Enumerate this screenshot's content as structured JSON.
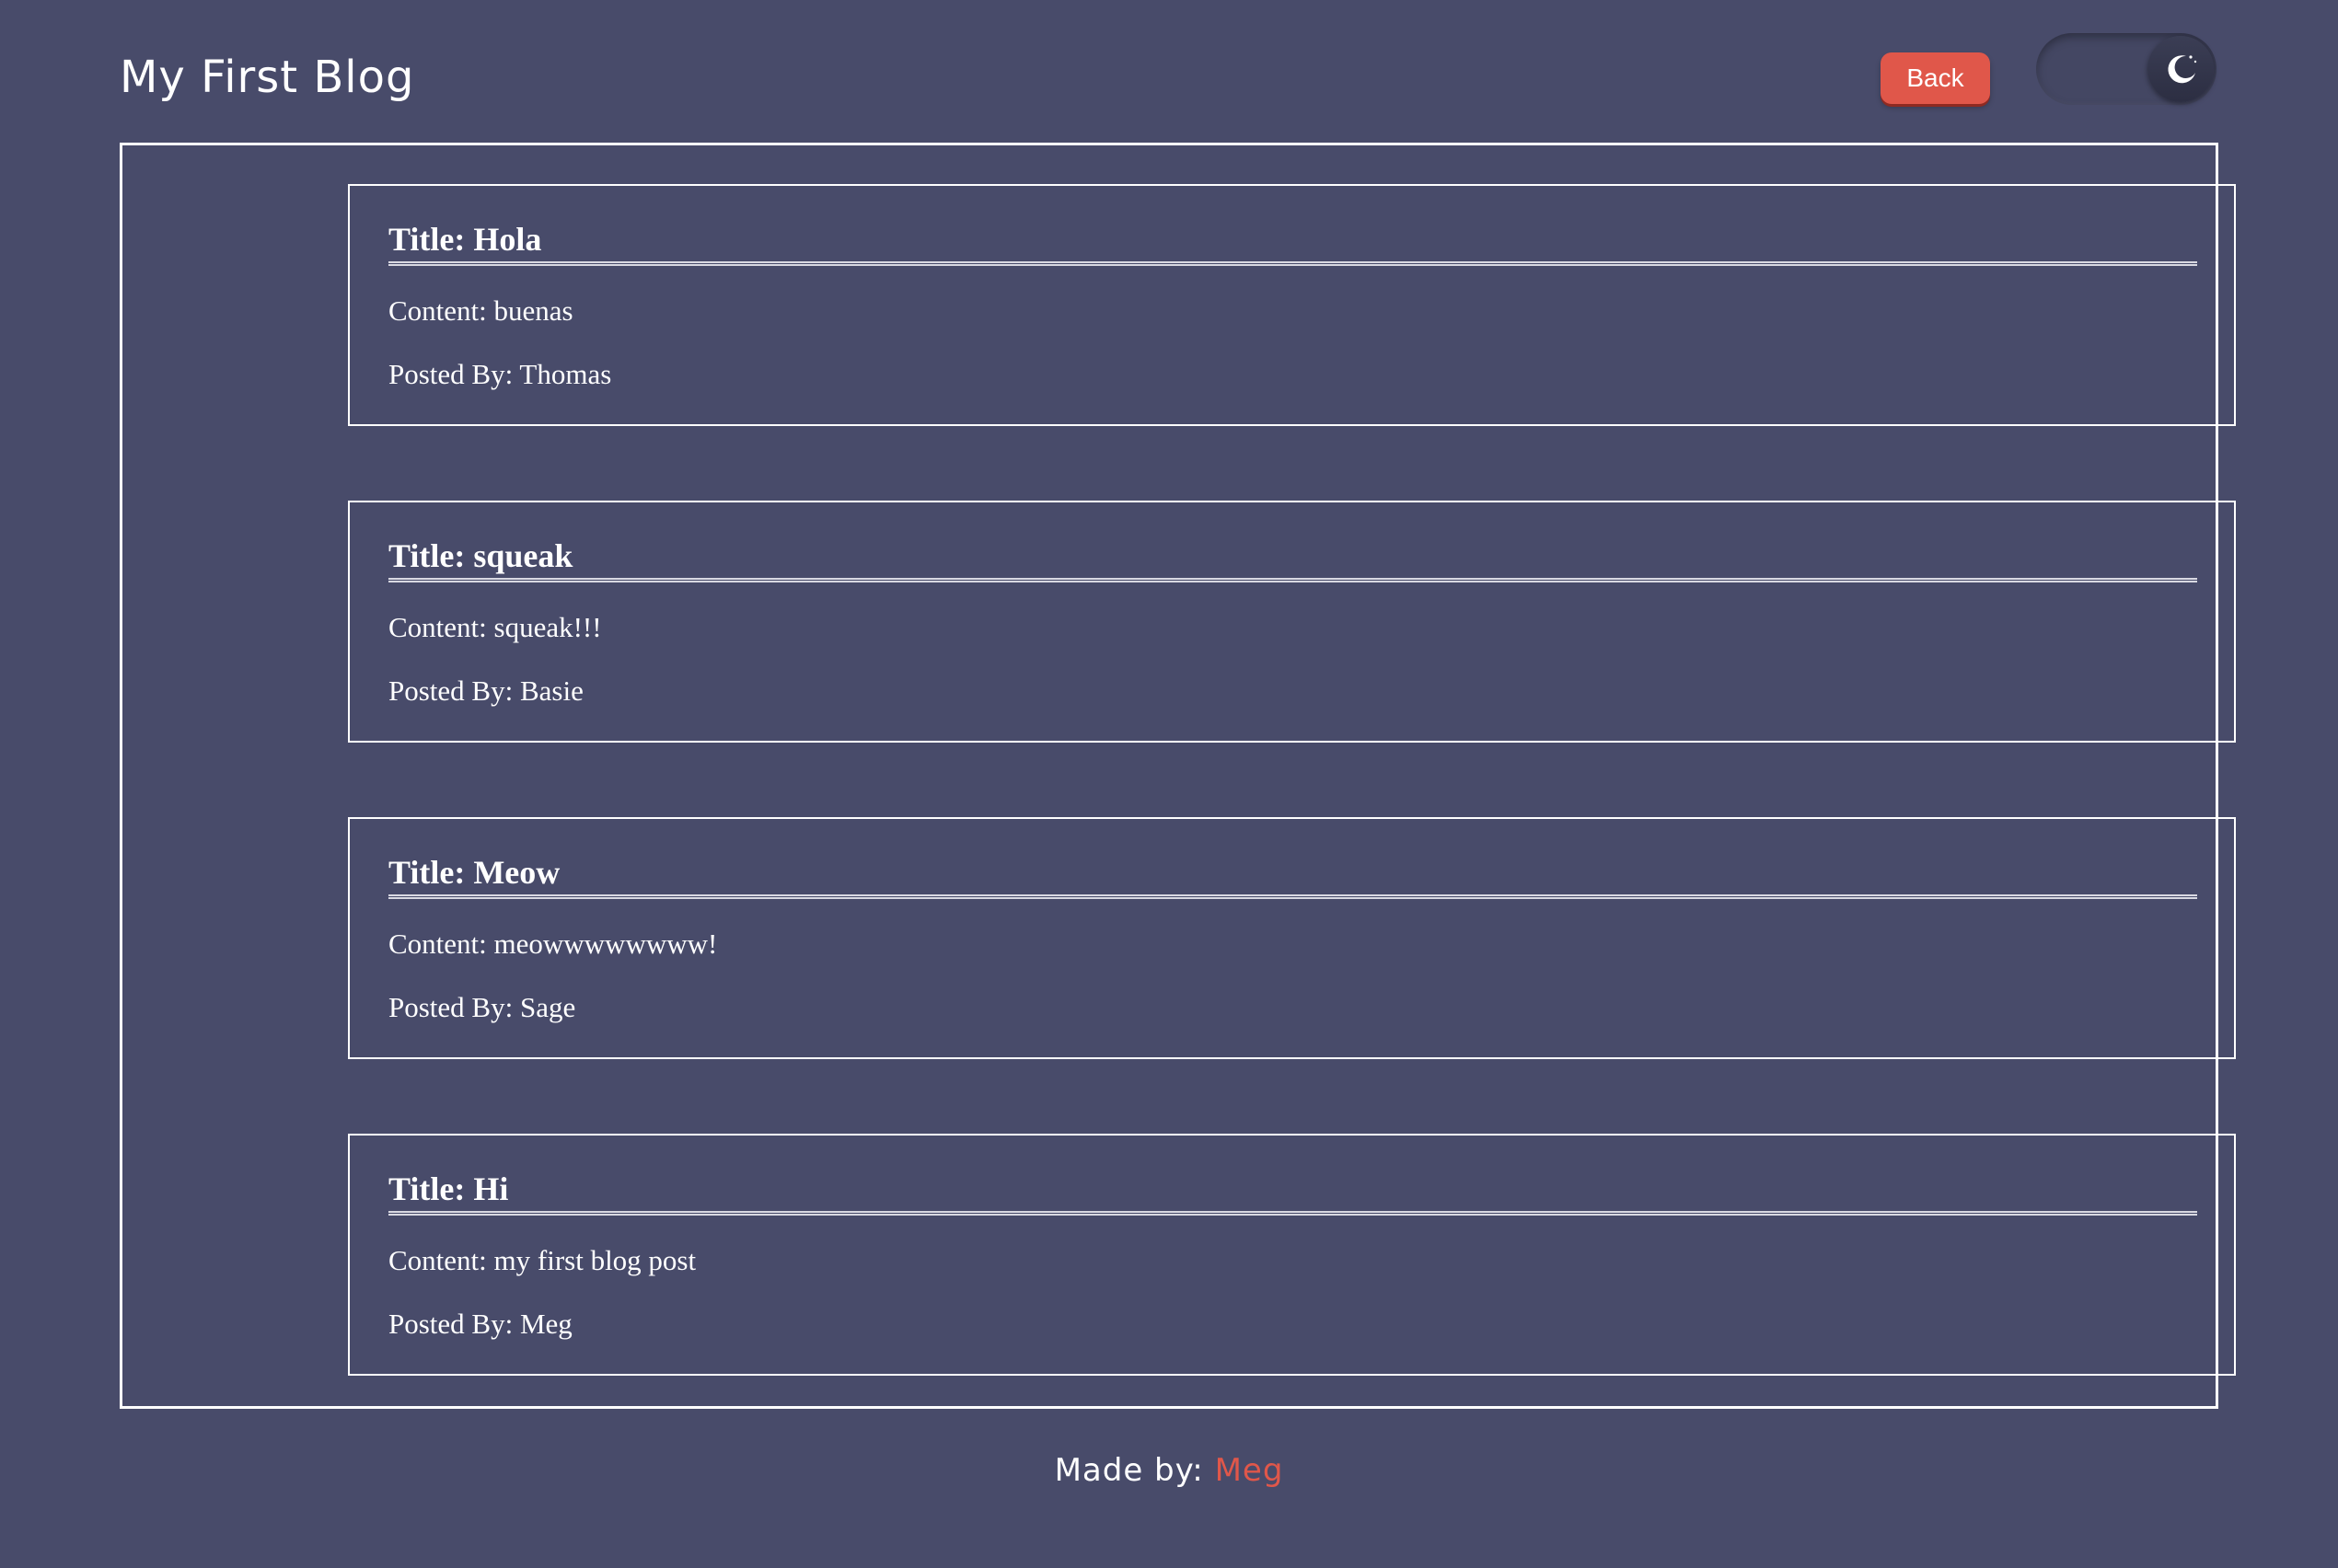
{
  "header": {
    "title": "My First Blog",
    "back_label": "Back",
    "theme_toggle_icon": "moon-icon"
  },
  "posts": [
    {
      "title": "Title: Hola",
      "content": "Content: buenas",
      "author": "Posted By: Thomas"
    },
    {
      "title": "Title: squeak",
      "content": "Content: squeak!!!",
      "author": "Posted By: Basie"
    },
    {
      "title": "Title: Meow",
      "content": "Content: meowwwwwwww!",
      "author": "Posted By: Sage"
    },
    {
      "title": "Title: Hi",
      "content": "Content: my first blog post",
      "author": "Posted By: Meg"
    }
  ],
  "footer": {
    "prefix": "Made by:",
    "author": "Meg"
  },
  "colors": {
    "background": "#484b6a",
    "accent": "#e0574a",
    "text": "#ffffff"
  }
}
